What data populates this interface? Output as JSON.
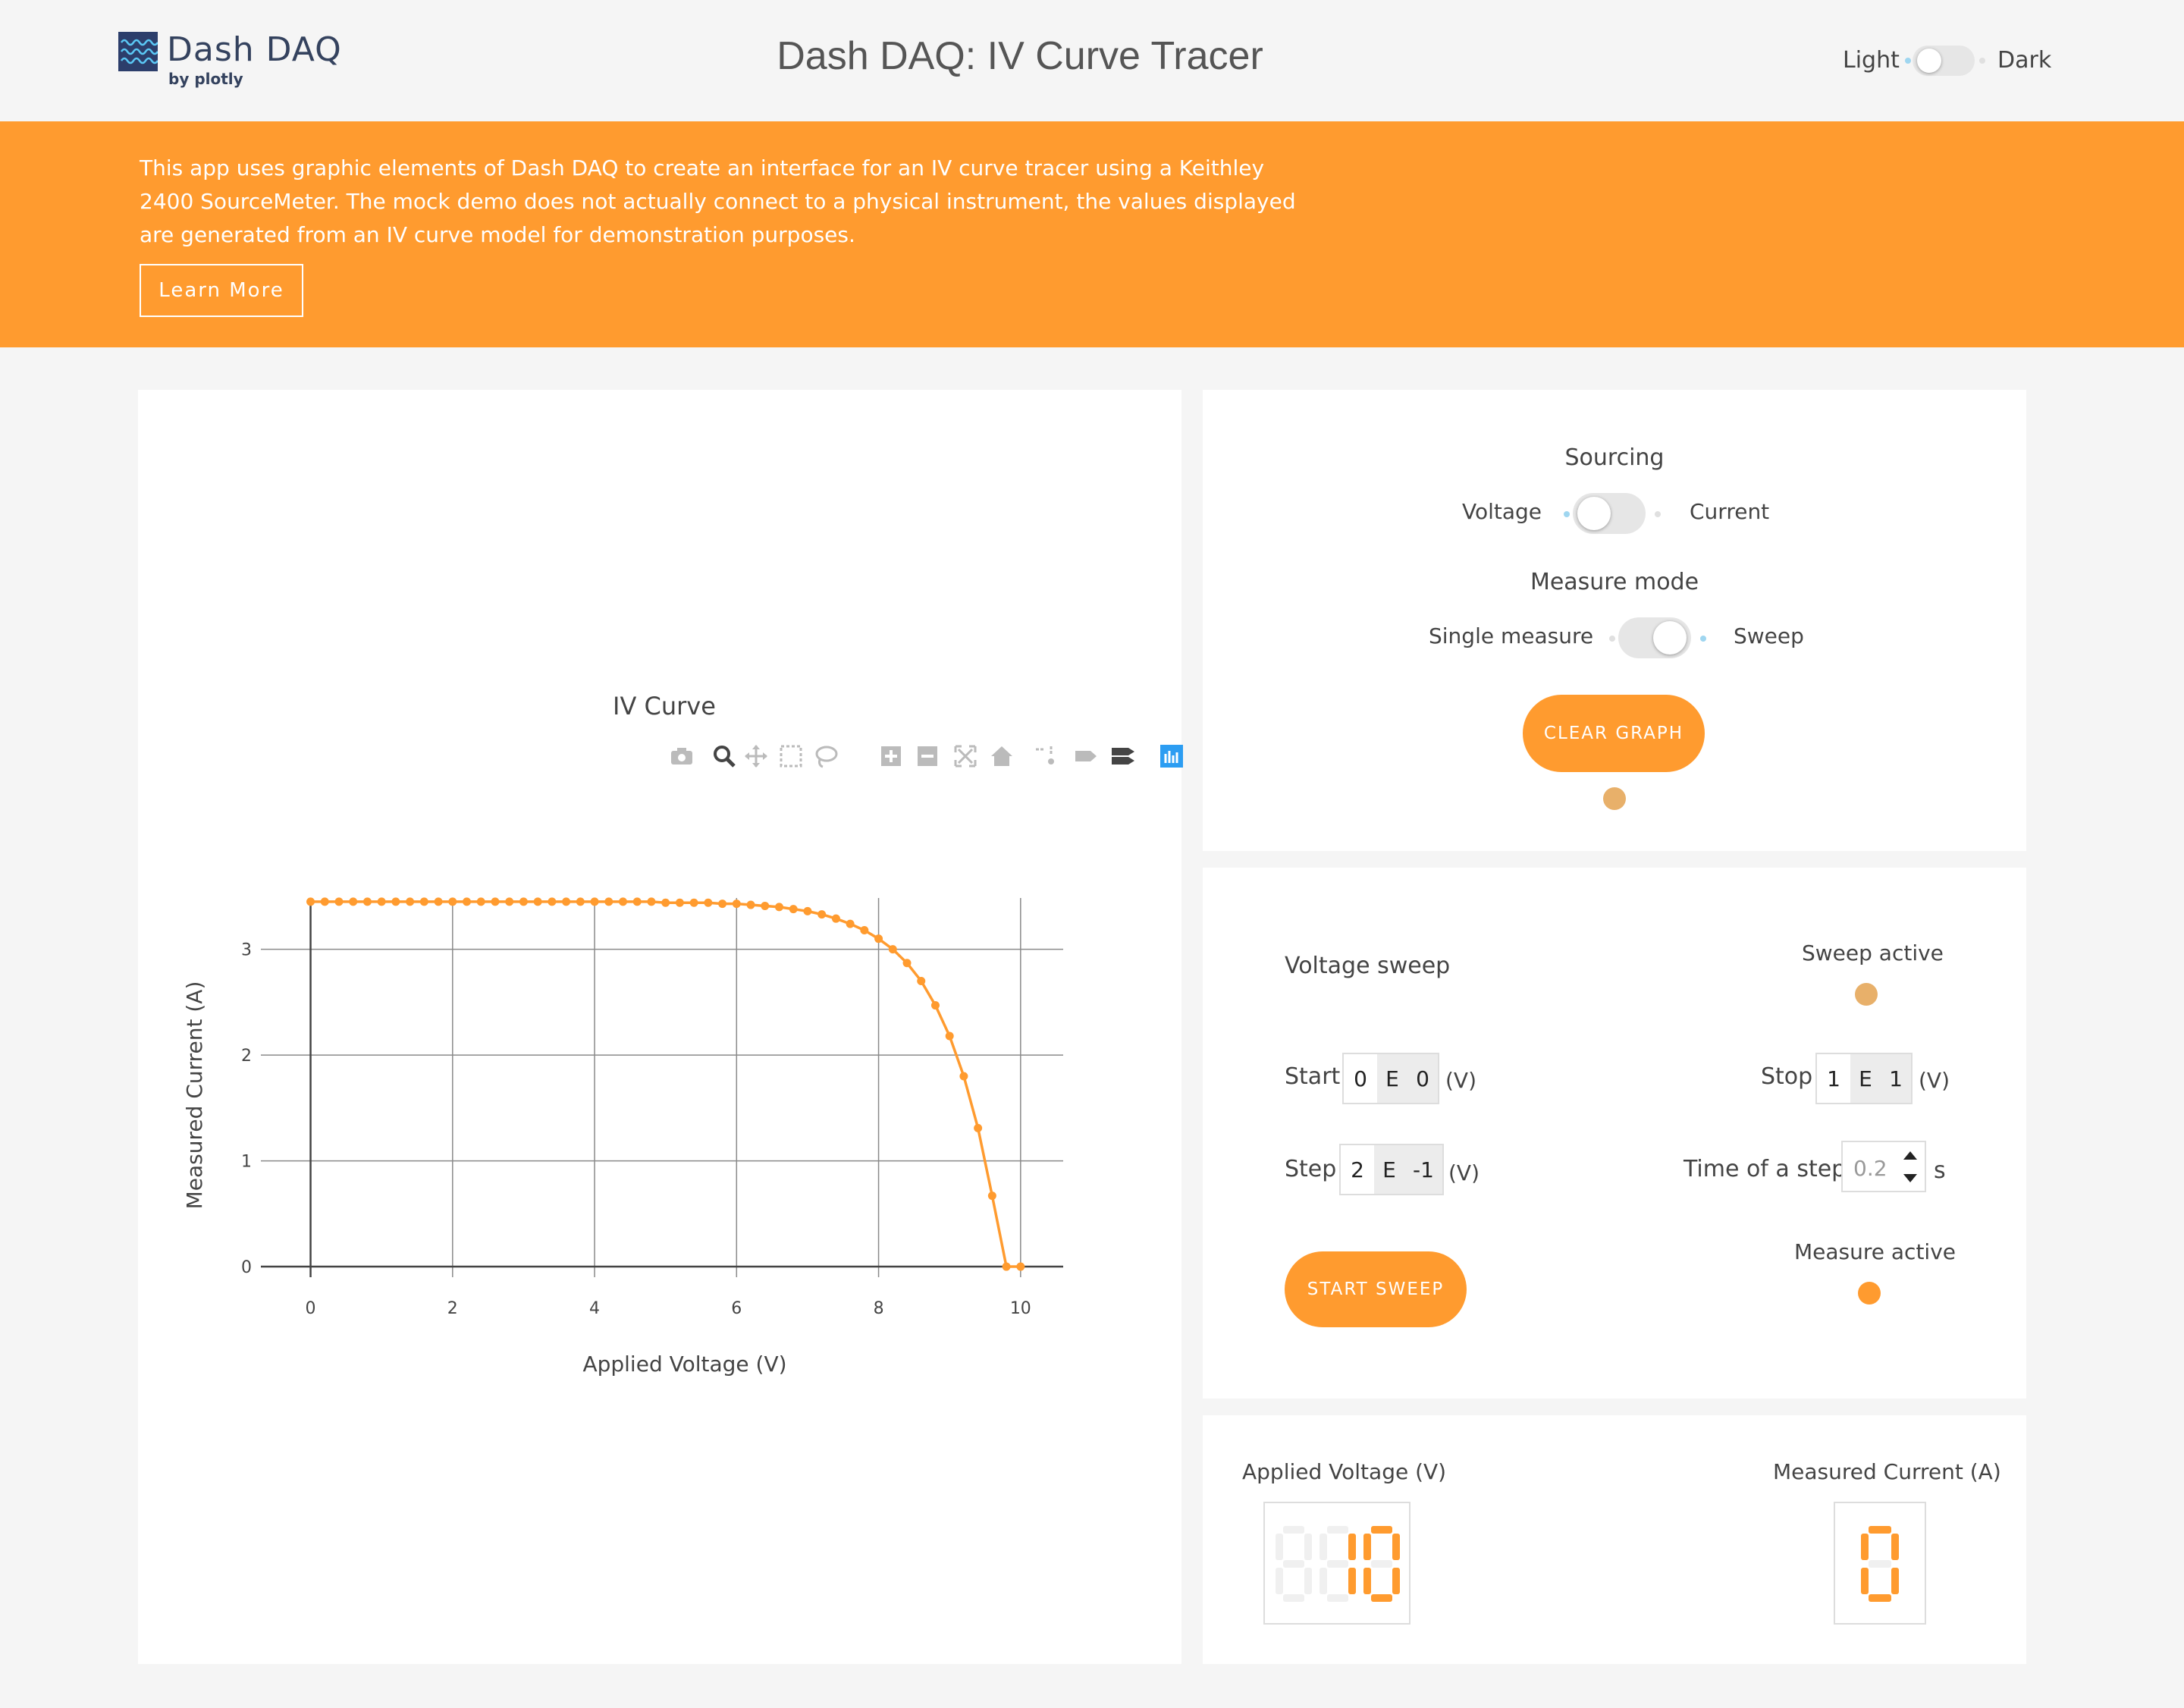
{
  "header": {
    "logo_text": "Dash DAQ",
    "logo_subtext": "by plotly",
    "title": "Dash DAQ: IV Curve Tracer",
    "theme_light_label": "Light",
    "theme_dark_label": "Dark"
  },
  "banner": {
    "text": "This app uses graphic elements of Dash DAQ to create an interface for an IV curve tracer using a Keithley 2400 SourceMeter. The mock demo does not actually connect to a physical instrument, the values displayed are generated from an IV curve model for demonstration purposes.",
    "button_label": "Learn More",
    "color": "#ff9b2f"
  },
  "graph": {
    "modebar_icons": [
      "camera-icon",
      "zoom-icon",
      "pan-icon",
      "box-select-icon",
      "lasso-select-icon",
      "zoom-in-icon",
      "zoom-out-icon",
      "autoscale-icon",
      "reset-axes-icon",
      "spike-lines-icon",
      "hover-closest-icon",
      "hover-compare-icon",
      "plotly-logo-icon"
    ]
  },
  "chart_data": {
    "type": "line",
    "title": "IV Curve",
    "xlabel": "Applied Voltage (V)",
    "ylabel": "Measured Current (A)",
    "xlim": [
      -0.7,
      10.6
    ],
    "ylim": [
      -0.1,
      3.7
    ],
    "xticks": [
      "0",
      "2",
      "4",
      "6",
      "8",
      "10"
    ],
    "yticks": [
      "0",
      "1",
      "2",
      "3"
    ],
    "grid": true,
    "series": [
      {
        "color": "#ff9b2f",
        "x": [
          0,
          0.2,
          0.4,
          0.6,
          0.8,
          1.0,
          1.2,
          1.4,
          1.6,
          1.8,
          2.0,
          2.2,
          2.4,
          2.6,
          2.8,
          3.0,
          3.2,
          3.4,
          3.6,
          3.8,
          4.0,
          4.2,
          4.4,
          4.6,
          4.8,
          5.0,
          5.2,
          5.4,
          5.6,
          5.8,
          6.0,
          6.2,
          6.4,
          6.6,
          6.8,
          7.0,
          7.2,
          7.4,
          7.6,
          7.8,
          8.0,
          8.2,
          8.4,
          8.6,
          8.8,
          9.0,
          9.2,
          9.4,
          9.6,
          9.8,
          10.0
        ],
        "y": [
          3.45,
          3.45,
          3.45,
          3.45,
          3.45,
          3.45,
          3.45,
          3.45,
          3.45,
          3.45,
          3.45,
          3.45,
          3.45,
          3.45,
          3.45,
          3.45,
          3.45,
          3.45,
          3.45,
          3.45,
          3.45,
          3.45,
          3.45,
          3.45,
          3.45,
          3.44,
          3.44,
          3.44,
          3.44,
          3.43,
          3.43,
          3.42,
          3.41,
          3.4,
          3.38,
          3.36,
          3.33,
          3.29,
          3.24,
          3.18,
          3.1,
          3.0,
          2.87,
          2.7,
          2.47,
          2.18,
          1.8,
          1.31,
          0.67,
          0.0,
          0.0
        ]
      }
    ]
  },
  "sourcing": {
    "title": "Sourcing",
    "left_label": "Voltage",
    "right_label": "Current",
    "mode_title": "Measure mode",
    "mode_left_label": "Single measure",
    "mode_right_label": "Sweep",
    "clear_button_label": "CLEAR GRAPH",
    "indicator_color": "#e8b06a"
  },
  "sweep": {
    "title": "Voltage sweep",
    "sweep_active_label": "Sweep active",
    "sweep_active_color": "#e8b06a",
    "start_label": "Start",
    "start": {
      "mantissa": "0",
      "e": "E",
      "exponent": "0"
    },
    "stop_label": "Stop",
    "stop": {
      "mantissa": "1",
      "e": "E",
      "exponent": "1"
    },
    "step_label": "Step",
    "step": {
      "mantissa": "2",
      "e": "E",
      "exponent": "-1"
    },
    "unit_v": "(V)",
    "time_label": "Time of a step",
    "time_value": "0.2",
    "time_unit": "s",
    "start_button_label": "START SWEEP",
    "measure_active_label": "Measure active",
    "measure_active_color": "#ff9b2f"
  },
  "display": {
    "voltage_label": "Applied Voltage (V)",
    "voltage_value": "10",
    "current_label": "Measured Current (A)",
    "current_value": "0",
    "led_color": "#ff9b2f"
  }
}
